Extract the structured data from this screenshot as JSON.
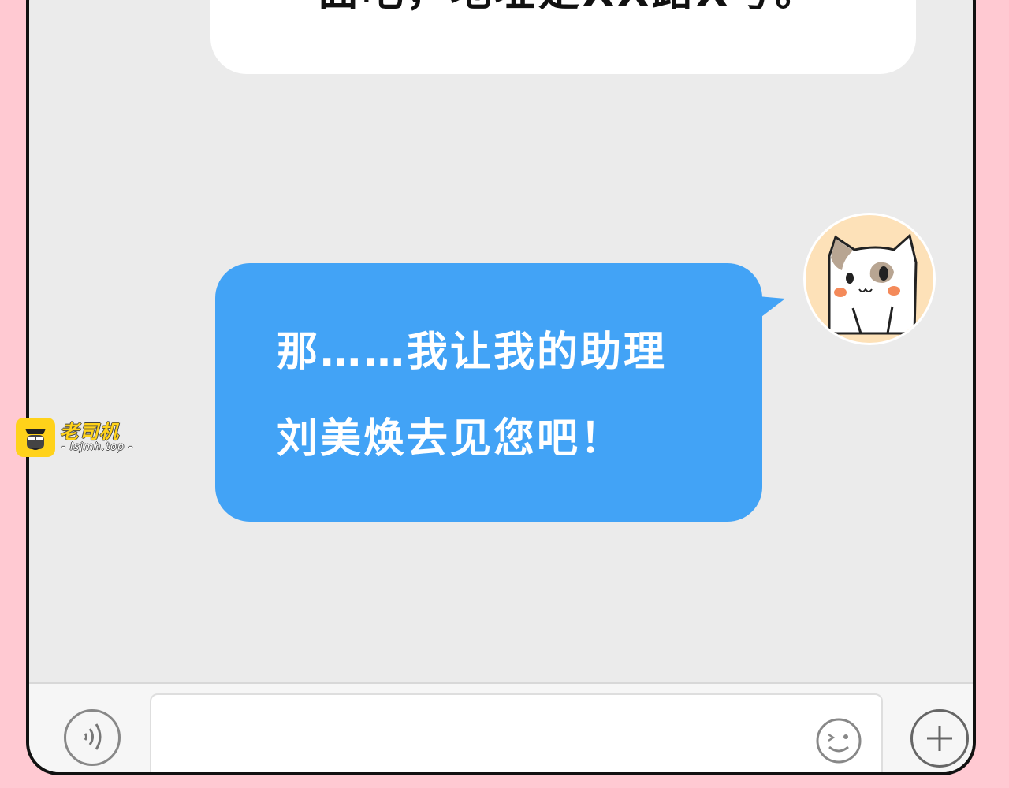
{
  "chat": {
    "previous_message": "一面吧，地址是XX路X号。",
    "message_lines": [
      "那……我让我的助理",
      "刘美焕去见您吧！"
    ]
  },
  "input_bar": {
    "voice_icon": "voice-icon",
    "emoji_icon": "emoji-icon",
    "plus_icon": "plus-icon"
  },
  "watermark": {
    "name": "老司机",
    "url": "- lsjmh.top -"
  },
  "colors": {
    "background": "#ffc9d2",
    "bubble_blue": "#42a3f6",
    "chat_bg": "#ebebeb"
  }
}
